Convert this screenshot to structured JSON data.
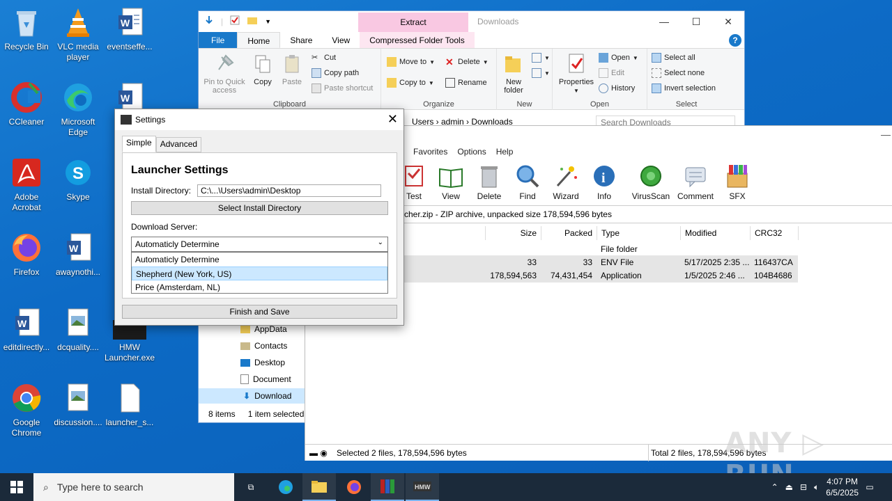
{
  "desktop": {
    "icons": [
      {
        "label": "Recycle Bin"
      },
      {
        "label": "VLC media player"
      },
      {
        "label": "eventseffe..."
      },
      {
        "label": "CCleaner"
      },
      {
        "label": "Microsoft Edge"
      },
      {
        "label": "fo"
      },
      {
        "label": "Adobe Acrobat"
      },
      {
        "label": "Skype"
      },
      {
        "label": "p"
      },
      {
        "label": "Firefox"
      },
      {
        "label": "awaynothi..."
      },
      {
        "label": "editdirectly..."
      },
      {
        "label": "dcquality...."
      },
      {
        "label": "HMW Launcher.exe"
      },
      {
        "label": "Google Chrome"
      },
      {
        "label": "discussion...."
      },
      {
        "label": "launcher_s..."
      }
    ]
  },
  "explorer": {
    "title": "Downloads",
    "context_tab": "Extract",
    "tabs": [
      "File",
      "Home",
      "Share",
      "View",
      "Compressed Folder Tools"
    ],
    "help": "?",
    "clipboard": {
      "pin": "Pin to Quick access",
      "copy": "Copy",
      "paste": "Paste",
      "cut": "Cut",
      "copy_path": "Copy path",
      "paste_shortcut": "Paste shortcut",
      "group": "Clipboard"
    },
    "organize": {
      "move_to": "Move to",
      "copy_to": "Copy to",
      "delete": "Delete",
      "rename": "Rename",
      "group": "Organize"
    },
    "new": {
      "new_folder": "New folder",
      "group": "New"
    },
    "open": {
      "properties": "Properties",
      "open": "Open",
      "edit": "Edit",
      "history": "History",
      "group": "Open"
    },
    "select": {
      "select_all": "Select all",
      "select_none": "Select none",
      "invert": "Invert selection",
      "group": "Select"
    },
    "address": "Users  ›  admin  ›  Downloads",
    "search_placeholder": "Search Downloads",
    "nav": [
      "AppData",
      "Contacts",
      "Desktop",
      "Document",
      "Download"
    ],
    "status_items": "8 items",
    "status_selected": "1 item selected"
  },
  "winrar": {
    "menu": [
      "Favorites",
      "Options",
      "Help"
    ],
    "toolbar": [
      "Test",
      "View",
      "Delete",
      "Find",
      "Wizard",
      "Info",
      "VirusScan",
      "Comment",
      "SFX"
    ],
    "path": "cher.zip - ZIP archive, unpacked size 178,594,596 bytes",
    "columns": [
      "Size",
      "Packed",
      "Type",
      "Modified",
      "CRC32"
    ],
    "rows": [
      {
        "size": "",
        "packed": "",
        "type": "File folder",
        "modified": "",
        "crc": ""
      },
      {
        "size": "33",
        "packed": "33",
        "type": "ENV File",
        "modified": "5/17/2025 2:35 ...",
        "crc": "116437CA"
      },
      {
        "size": "178,594,563",
        "packed": "74,431,454",
        "type": "Application",
        "modified": "1/5/2025 2:46 ...",
        "crc": "104B4686"
      }
    ],
    "status_left": "Selected 2 files, 178,594,596 bytes",
    "status_right": "Total 2 files, 178,594,596 bytes"
  },
  "settings": {
    "title": "Settings",
    "close": "✕",
    "tabs": [
      "Simple",
      "Advanced"
    ],
    "heading": "Launcher Settings",
    "install_label": "Install Directory:",
    "install_value": "C:\\...\\Users\\admin\\Desktop",
    "select_dir_button": "Select Install Directory",
    "server_label": "Download Server:",
    "server_selected": "Automaticly Determine",
    "server_options": [
      "Automaticly Determine",
      "Shepherd (New York, US)",
      "Price (Amsterdam, NL)"
    ],
    "highlighted_option": "Shepherd (New York, US)",
    "finish_button": "Finish and Save"
  },
  "taskbar": {
    "search_placeholder": "Type here to search",
    "time": "4:07 PM",
    "date": "6/5/2025"
  },
  "watermark": "ANY ▷ RUN"
}
